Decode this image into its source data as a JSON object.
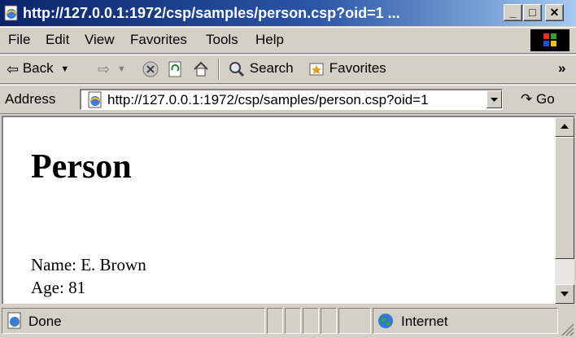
{
  "window": {
    "title": "http://127.0.0.1:1972/csp/samples/person.csp?oid=1 ...",
    "minimize_label": "_",
    "maximize_label": "□",
    "close_label": "✕"
  },
  "menu": {
    "file": "File",
    "edit": "Edit",
    "view": "View",
    "favorites": "Favorites",
    "tools": "Tools",
    "help": "Help"
  },
  "toolbar": {
    "back_label": "Back",
    "search_label": "Search",
    "favorites_label": "Favorites",
    "overflow": "»"
  },
  "address": {
    "label": "Address",
    "url": "http://127.0.0.1:1972/csp/samples/person.csp?oid=1",
    "go_label": "Go"
  },
  "page": {
    "heading": "Person",
    "name_line": "Name: E. Brown",
    "age_line": "Age: 81"
  },
  "status": {
    "text": "Done",
    "zone": "Internet"
  },
  "colors": {
    "titlebar_start": "#0a246a",
    "titlebar_end": "#a6caf0",
    "chrome": "#d4d0c8"
  }
}
